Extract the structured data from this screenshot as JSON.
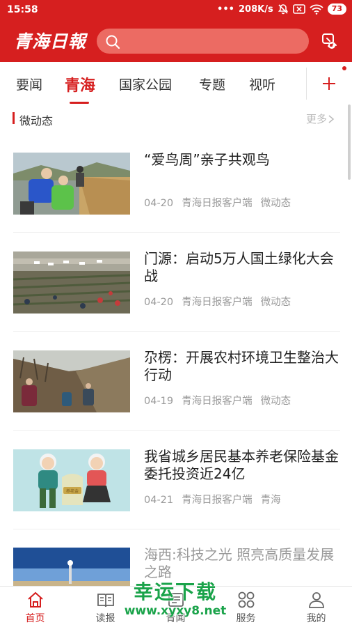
{
  "status_bar": {
    "time": "15:58",
    "network_speed": "208K/s",
    "battery": "73"
  },
  "header": {
    "logo_text": "青海日報",
    "search_placeholder": "",
    "brand_color": "#d61f1f"
  },
  "tabs": [
    {
      "label": "要闻",
      "active": false
    },
    {
      "label": "青海",
      "active": true
    },
    {
      "label": "国家公园",
      "active": false
    },
    {
      "label": "专题",
      "active": false
    },
    {
      "label": "视听",
      "active": false
    }
  ],
  "section": {
    "title": "微动态",
    "more_label": "更多"
  },
  "articles": [
    {
      "title": "“爱鸟周”亲子共观鸟",
      "date": "04-20",
      "source": "青海日报客户端",
      "tag": "微动态",
      "thumb": "birdwatching"
    },
    {
      "title": "门源：启动5万人国土绿化大会战",
      "date": "04-20",
      "source": "青海日报客户端",
      "tag": "微动态",
      "thumb": "afforestation"
    },
    {
      "title": "尕楞：开展农村环境卫生整治大行动",
      "date": "04-19",
      "source": "青海日报客户端",
      "tag": "微动态",
      "thumb": "cleanup"
    },
    {
      "title": "我省城乡居民基本养老保险基金委托投资近24亿",
      "date": "04-21",
      "source": "青海日报客户端",
      "tag": "青海",
      "thumb": "pension"
    },
    {
      "title": "海西:科技之光 照亮高质量发展之路",
      "date": "",
      "source": "",
      "tag": "",
      "thumb": "solar"
    }
  ],
  "bottom_nav": [
    {
      "label": "首页",
      "icon": "home-icon",
      "active": true
    },
    {
      "label": "读报",
      "icon": "book-icon",
      "active": false
    },
    {
      "label": "青闻",
      "icon": "news-icon",
      "active": false
    },
    {
      "label": "服务",
      "icon": "grid-icon",
      "active": false
    },
    {
      "label": "我的",
      "icon": "person-icon",
      "active": false
    }
  ],
  "watermark": {
    "top": "幸运下载",
    "bottom": "www.xyxy8.net"
  }
}
